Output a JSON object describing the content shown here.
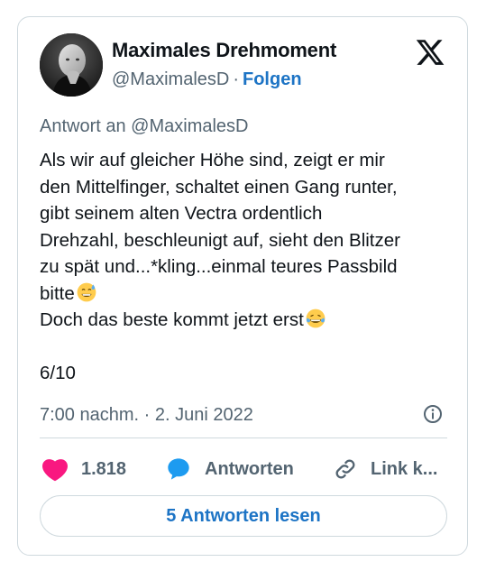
{
  "author": {
    "name": "Maximales Drehmoment",
    "handle": "@MaximalesD",
    "separator": "·",
    "follow_label": "Folgen"
  },
  "tweet": {
    "reply_to": "Antwort an @MaximalesD",
    "lines": [
      "Als wir auf gleicher Höhe sind, zeigt er mir",
      "den Mittelfinger, schaltet einen Gang runter,",
      "gibt seinem alten Vectra ordentlich",
      "Drehzahl, beschleunigt auf, sieht den Blitzer",
      "zu spät und...*kling...einmal teures Passbild",
      "bitte",
      "Doch das beste kommt jetzt erst"
    ],
    "emojis": [
      "grinning-sweat-emoji",
      "tears-of-joy-emoji"
    ],
    "rating": "6/10",
    "timestamp": "7:00 nachm. · 2. Juni 2022"
  },
  "actions": {
    "like_count": "1.818",
    "reply_label": "Antworten",
    "link_label": "Link k..."
  },
  "footer": {
    "read_replies_label": "5 Antworten lesen"
  },
  "colors": {
    "like": "#f91880",
    "reply": "#1d9bf0",
    "link_blue": "#1d74c5",
    "muted": "#536471",
    "border": "#cfd9de"
  },
  "icons": [
    "x-logo-icon",
    "info-icon",
    "heart-icon",
    "speech-bubble-icon",
    "link-icon"
  ]
}
